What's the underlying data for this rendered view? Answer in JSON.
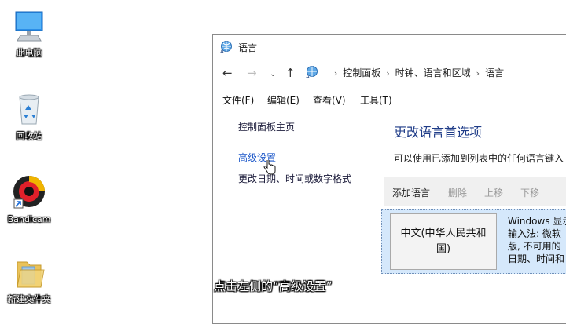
{
  "desktop": {
    "icons": [
      {
        "label": "此电脑"
      },
      {
        "label": "回收站"
      },
      {
        "label": "Bandicam"
      },
      {
        "label": "新建文件夹"
      }
    ]
  },
  "window": {
    "title": "语言",
    "address": {
      "crumbs": [
        "控制面板",
        "时钟、语言和区域",
        "语言"
      ]
    },
    "menu": [
      "文件(F)",
      "编辑(E)",
      "查看(V)",
      "工具(T)"
    ],
    "left_links": {
      "home": "控制面板主页",
      "advanced": "高级设置",
      "datetime": "更改日期、时间或数字格式"
    },
    "main": {
      "heading": "更改语言首选项",
      "description": "可以使用已添加到列表中的任何语言键入",
      "toolbar": {
        "add": "添加语言",
        "remove": "删除",
        "move_up": "上移",
        "move_down": "下移"
      },
      "language": {
        "name": "中文(中华人民共和国)",
        "info_lines": [
          "Windows 显示",
          "输入法: 微软",
          "版, 不可用的",
          "日期、时间和"
        ]
      }
    }
  },
  "subtitle": "点击左侧的“高级设置”"
}
